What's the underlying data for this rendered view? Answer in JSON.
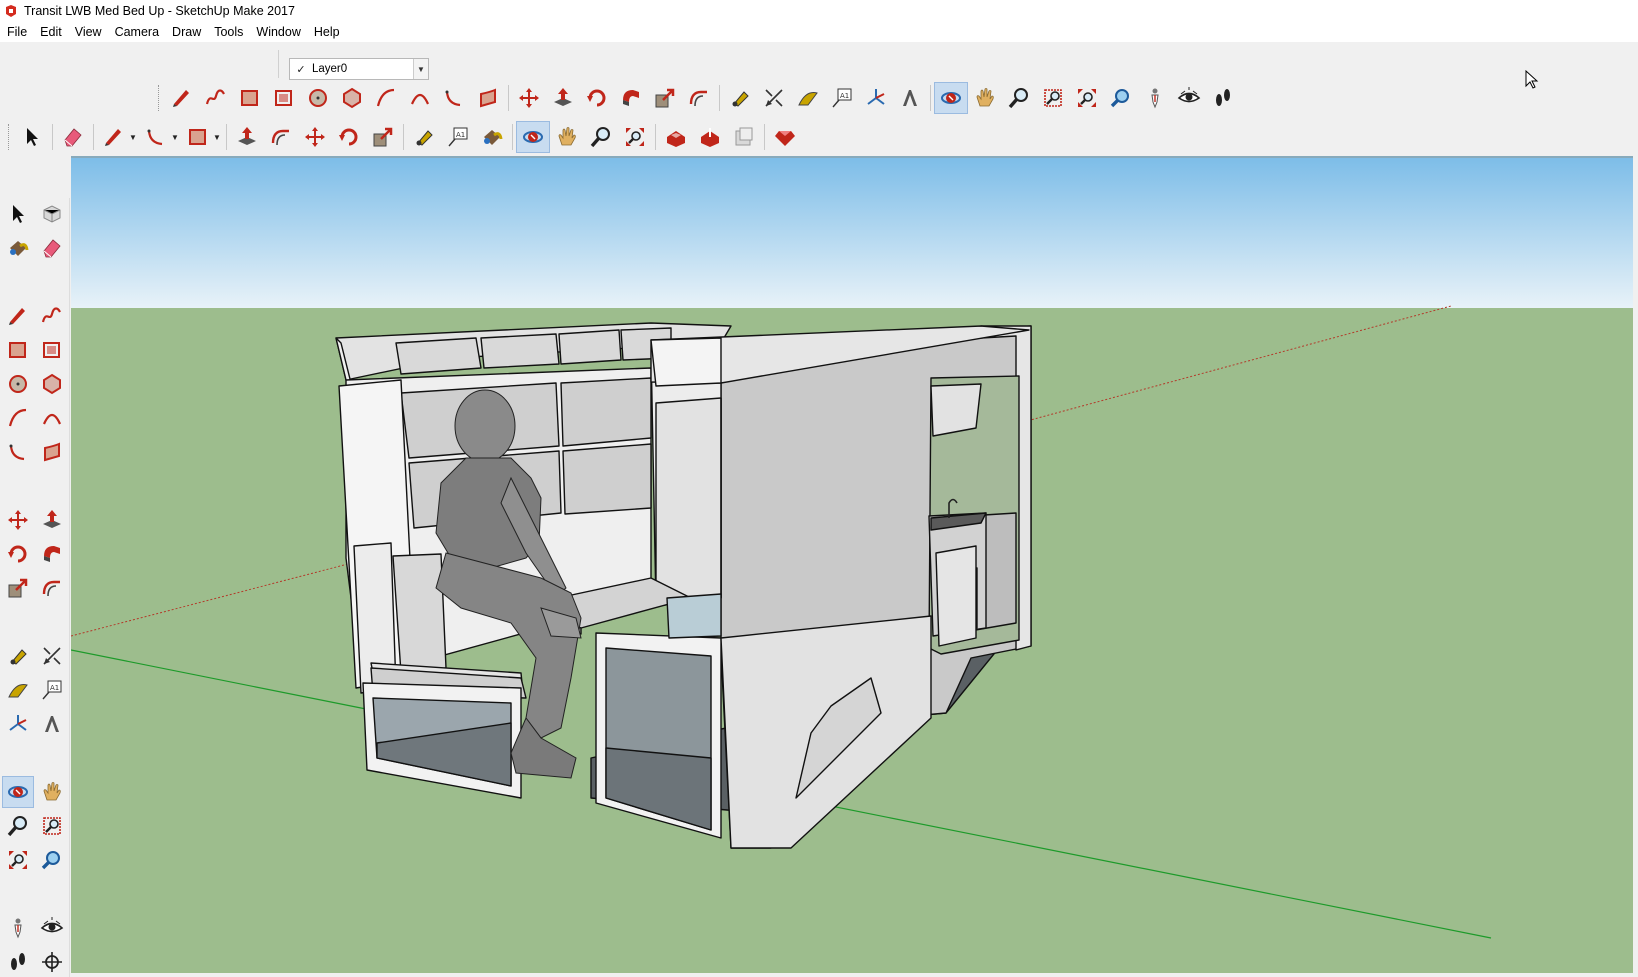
{
  "window": {
    "title": "Transit LWB Med Bed Up - SketchUp Make 2017"
  },
  "menubar": {
    "items": [
      "File",
      "Edit",
      "View",
      "Camera",
      "Draw",
      "Tools",
      "Window",
      "Help"
    ]
  },
  "layers": {
    "current_layer": "Layer0",
    "check_mark": "✓"
  },
  "toolbar_row1": [
    {
      "name": "line-tool-button",
      "icon": "pencil-icon",
      "color": "#c0261a"
    },
    {
      "name": "freehand-tool-button",
      "icon": "freehand-icon",
      "color": "#c0261a"
    },
    {
      "name": "rectangle-tool-button",
      "icon": "rectangle-icon",
      "color": "#c0261a"
    },
    {
      "name": "rotated-rectangle-button",
      "icon": "rotated-rectangle-icon",
      "color": "#c0261a"
    },
    {
      "name": "circle-tool-button",
      "icon": "circle-icon",
      "color": "#c0261a"
    },
    {
      "name": "polygon-tool-button",
      "icon": "polygon-icon",
      "color": "#c0261a"
    },
    {
      "name": "arc-tool-button",
      "icon": "arc-icon",
      "color": "#c0261a"
    },
    {
      "name": "two-point-arc-button",
      "icon": "two-point-arc-icon",
      "color": "#c0261a"
    },
    {
      "name": "three-point-arc-button",
      "icon": "three-point-arc-icon",
      "color": "#c0261a"
    },
    {
      "name": "pie-tool-button",
      "icon": "pie-icon",
      "color": "#c0261a"
    },
    {
      "sep": true
    },
    {
      "name": "move-tool-button",
      "icon": "move-icon",
      "color": "#c0261a"
    },
    {
      "name": "push-pull-button",
      "icon": "push-pull-icon",
      "color": "#c0261a"
    },
    {
      "name": "rotate-tool-button",
      "icon": "rotate-icon",
      "color": "#c0261a"
    },
    {
      "name": "follow-me-button",
      "icon": "follow-me-icon",
      "color": "#c0261a"
    },
    {
      "name": "scale-tool-button",
      "icon": "scale-icon",
      "color": "#c0261a"
    },
    {
      "name": "offset-tool-button",
      "icon": "offset-icon",
      "color": "#c0261a"
    },
    {
      "sep": true
    },
    {
      "name": "tape-measure-button",
      "icon": "tape-measure-icon",
      "color": "#c8a400"
    },
    {
      "name": "dimension-tool-button",
      "icon": "dimension-icon",
      "color": "#333333"
    },
    {
      "name": "protractor-button",
      "icon": "protractor-icon",
      "color": "#c8a400"
    },
    {
      "name": "text-tool-button",
      "icon": "text-icon",
      "color": "#333333"
    },
    {
      "name": "axes-tool-button",
      "icon": "axes-icon",
      "color": "#2a6ab0"
    },
    {
      "name": "3d-text-button",
      "icon": "3d-text-icon",
      "color": "#333333"
    },
    {
      "sep": true
    },
    {
      "name": "orbit-tool-button",
      "icon": "orbit-icon",
      "color": "#2a6ab0",
      "active": true
    },
    {
      "name": "pan-tool-button",
      "icon": "pan-hand-icon",
      "color": "#e0b060"
    },
    {
      "name": "zoom-tool-button",
      "icon": "zoom-icon",
      "color": "#2a6ab0"
    },
    {
      "name": "zoom-window-button",
      "icon": "zoom-window-icon",
      "color": "#c0261a"
    },
    {
      "name": "zoom-extents-button",
      "icon": "zoom-extents-icon",
      "color": "#2a6ab0"
    },
    {
      "name": "previous-view-button",
      "icon": "previous-view-icon",
      "color": "#2a6ab0"
    },
    {
      "name": "position-camera-button",
      "icon": "position-camera-icon",
      "color": "#c0261a"
    },
    {
      "name": "look-around-button",
      "icon": "eye-icon",
      "color": "#333333"
    },
    {
      "name": "walk-tool-button",
      "icon": "footprints-icon",
      "color": "#222222"
    }
  ],
  "toolbar_row2": [
    {
      "name": "select-tool-button",
      "icon": "arrow-cursor-icon",
      "color": "#111111"
    },
    {
      "sep": true
    },
    {
      "name": "eraser-tool-button",
      "icon": "eraser-icon",
      "color": "#e85a7a"
    },
    {
      "sep": true
    },
    {
      "name": "line-tool-button-2",
      "icon": "pencil-icon",
      "color": "#c0261a",
      "dropdown": true
    },
    {
      "name": "arc-tool-button-2",
      "icon": "three-point-arc-icon",
      "color": "#c0261a",
      "dropdown": true
    },
    {
      "name": "shape-tool-button",
      "icon": "rectangle-icon",
      "color": "#c0261a",
      "dropdown": true
    },
    {
      "sep": true
    },
    {
      "name": "push-pull-button-2",
      "icon": "push-pull-icon",
      "color": "#c0261a"
    },
    {
      "name": "offset-tool-button-2",
      "icon": "offset-icon",
      "color": "#c0261a"
    },
    {
      "name": "move-tool-button-2",
      "icon": "move-icon",
      "color": "#c0261a"
    },
    {
      "name": "rotate-tool-button-2",
      "icon": "rotate-icon",
      "color": "#c0261a"
    },
    {
      "name": "scale-tool-button-2",
      "icon": "scale-icon",
      "color": "#c0261a"
    },
    {
      "sep": true
    },
    {
      "name": "tape-measure-button-2",
      "icon": "tape-measure-icon",
      "color": "#c8a400"
    },
    {
      "name": "text-tool-button-2",
      "icon": "text-icon",
      "color": "#333333"
    },
    {
      "name": "paint-bucket-button",
      "icon": "paint-bucket-icon",
      "color": "#c8a400"
    },
    {
      "sep": true
    },
    {
      "name": "orbit-tool-button-2",
      "icon": "orbit-icon",
      "color": "#2a6ab0",
      "active": true
    },
    {
      "name": "pan-tool-button-2",
      "icon": "pan-hand-icon",
      "color": "#e0b060"
    },
    {
      "name": "zoom-tool-button-2",
      "icon": "zoom-icon",
      "color": "#2a6ab0"
    },
    {
      "name": "zoom-extents-button-2",
      "icon": "zoom-extents-icon",
      "color": "#2a6ab0"
    },
    {
      "sep": true
    },
    {
      "name": "3d-warehouse-button",
      "icon": "warehouse-icon",
      "color": "#c0261a"
    },
    {
      "name": "share-model-button",
      "icon": "share-model-icon",
      "color": "#c0261a"
    },
    {
      "name": "share-component-button",
      "icon": "share-component-icon",
      "color": "#999999"
    },
    {
      "sep": true
    },
    {
      "name": "extension-warehouse-button",
      "icon": "ruby-gem-icon",
      "color": "#c0261a"
    }
  ],
  "left_toolbar": [
    {
      "name": "select-tool",
      "icon": "arrow-cursor-icon",
      "color": "#111111"
    },
    {
      "name": "make-component-tool",
      "icon": "component-icon",
      "color": "#888888"
    },
    {
      "name": "paint-bucket-tool",
      "icon": "paint-bucket-icon",
      "color": "#c8a400"
    },
    {
      "name": "eraser-tool",
      "icon": "eraser-icon",
      "color": "#e85a7a"
    },
    {
      "sep": true
    },
    {
      "name": "line-tool",
      "icon": "pencil-icon",
      "color": "#c0261a"
    },
    {
      "name": "freehand-tool",
      "icon": "freehand-icon",
      "color": "#c0261a"
    },
    {
      "name": "rectangle-tool",
      "icon": "rectangle-icon",
      "color": "#c0261a"
    },
    {
      "name": "rotated-rectangle-tool",
      "icon": "rotated-rectangle-icon",
      "color": "#c0261a"
    },
    {
      "name": "circle-tool",
      "icon": "circle-icon",
      "color": "#c0261a"
    },
    {
      "name": "polygon-tool",
      "icon": "polygon-icon",
      "color": "#c0261a"
    },
    {
      "name": "arc-tool",
      "icon": "arc-icon",
      "color": "#c0261a"
    },
    {
      "name": "two-point-arc-tool",
      "icon": "two-point-arc-icon",
      "color": "#c0261a"
    },
    {
      "name": "three-point-arc-tool",
      "icon": "three-point-arc-icon",
      "color": "#c0261a"
    },
    {
      "name": "pie-tool",
      "icon": "pie-icon",
      "color": "#c0261a"
    },
    {
      "sep": true
    },
    {
      "name": "move-tool",
      "icon": "move-icon",
      "color": "#c0261a"
    },
    {
      "name": "push-pull-tool",
      "icon": "push-pull-icon",
      "color": "#c0261a"
    },
    {
      "name": "rotate-tool",
      "icon": "rotate-icon",
      "color": "#c0261a"
    },
    {
      "name": "follow-me-tool",
      "icon": "follow-me-icon",
      "color": "#c0261a"
    },
    {
      "name": "scale-tool",
      "icon": "scale-icon",
      "color": "#c0261a"
    },
    {
      "name": "offset-tool",
      "icon": "offset-icon",
      "color": "#c0261a"
    },
    {
      "sep": true
    },
    {
      "name": "tape-measure-tool",
      "icon": "tape-measure-icon",
      "color": "#c8a400"
    },
    {
      "name": "dimension-tool",
      "icon": "dimension-icon",
      "color": "#333333"
    },
    {
      "name": "protractor-tool",
      "icon": "protractor-icon",
      "color": "#c8a400"
    },
    {
      "name": "text-tool",
      "icon": "text-icon",
      "color": "#333333"
    },
    {
      "name": "axes-tool",
      "icon": "axes-icon",
      "color": "#2a6ab0"
    },
    {
      "name": "3d-text-tool",
      "icon": "3d-text-icon",
      "color": "#333333"
    },
    {
      "sep": true
    },
    {
      "name": "orbit-tool",
      "icon": "orbit-icon",
      "color": "#2a6ab0",
      "active": true
    },
    {
      "name": "pan-tool",
      "icon": "pan-hand-icon",
      "color": "#e0b060"
    },
    {
      "name": "zoom-tool",
      "icon": "zoom-icon",
      "color": "#2a6ab0"
    },
    {
      "name": "zoom-window-tool",
      "icon": "zoom-window-icon",
      "color": "#c0261a"
    },
    {
      "name": "zoom-extents-tool",
      "icon": "zoom-extents-icon",
      "color": "#2a6ab0"
    },
    {
      "name": "previous-view-tool",
      "icon": "previous-view-icon",
      "color": "#2a6ab0"
    },
    {
      "sep": true
    },
    {
      "name": "position-camera-tool",
      "icon": "position-camera-icon",
      "color": "#c0261a"
    },
    {
      "name": "look-around-tool",
      "icon": "eye-icon",
      "color": "#333333"
    },
    {
      "name": "walk-tool",
      "icon": "footprints-icon",
      "color": "#222222"
    },
    {
      "name": "section-plane-tool",
      "icon": "section-plane-icon",
      "color": "#333333"
    }
  ],
  "viewport": {
    "sky_top_color": "#7dbde8",
    "sky_bottom_color": "#e8f2f8",
    "ground_color": "#9dbd8d",
    "axis_red_color": "#b33a2a",
    "axis_green_color": "#1d9a2a"
  }
}
